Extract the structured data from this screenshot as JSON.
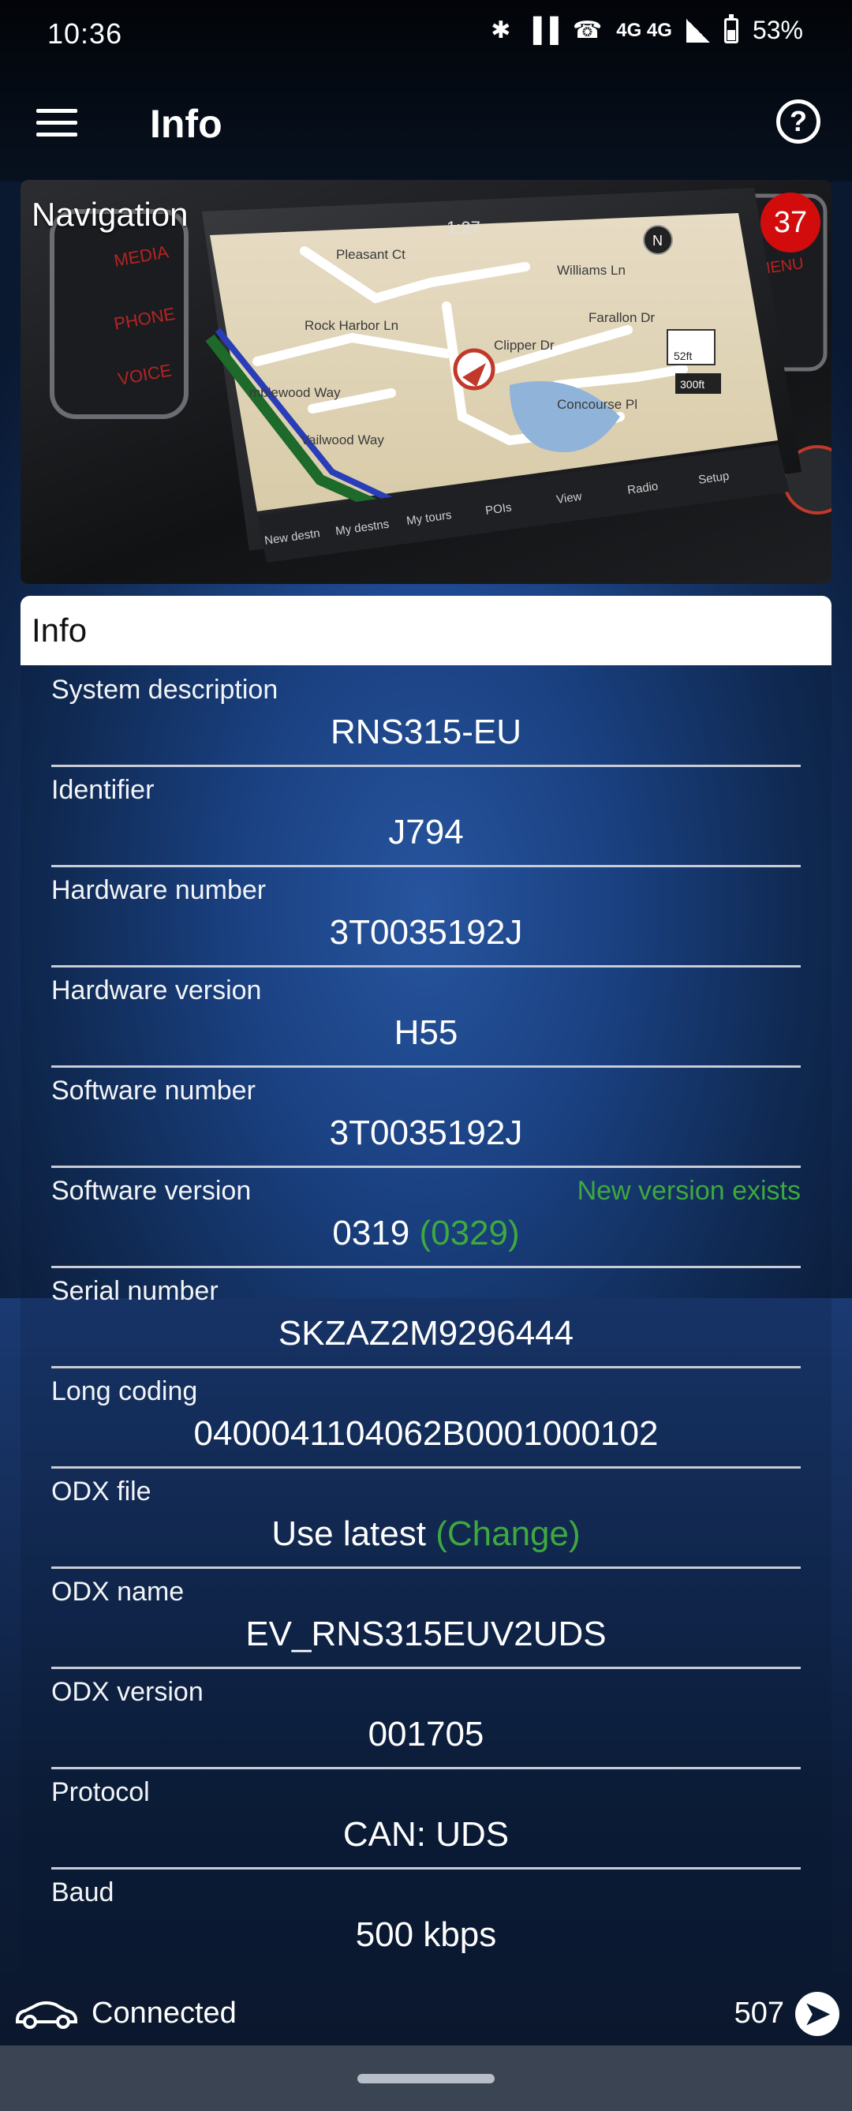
{
  "status_bar": {
    "time": "10:36",
    "network": "4G 4G",
    "battery": "53%"
  },
  "app_bar": {
    "title": "Info"
  },
  "hero": {
    "title": "Navigation",
    "badge": "37",
    "screen": {
      "time": "1:27",
      "streets": [
        "Pleasant Ct",
        "Williams Ln",
        "Rock Harbor Ln",
        "Farallon Dr",
        "Clipper Dr",
        "Concourse Pl",
        "Vailwood Way",
        "mblewood Way"
      ],
      "buttons": [
        "MEDIA",
        "PHONE",
        "VOICE",
        "MENU"
      ],
      "bottom_menu": [
        "New destn",
        "My destns",
        "My tours",
        "POIs",
        "View",
        "Radio",
        "Setup"
      ],
      "scale": [
        "52ft",
        "300ft"
      ]
    }
  },
  "card": {
    "title": "Info",
    "rows": [
      {
        "label": "System description",
        "value": "RNS315-EU"
      },
      {
        "label": "Identifier",
        "value": "J794"
      },
      {
        "label": "Hardware number",
        "value": "3T0035192J"
      },
      {
        "label": "Hardware version",
        "value": "H55"
      },
      {
        "label": "Software number",
        "value": "3T0035192J"
      },
      {
        "label": "Software version",
        "value": "0319",
        "value_extra": "(0329)",
        "note": "New version exists"
      },
      {
        "label": "Serial number",
        "value": "SKZAZ2M9296444"
      },
      {
        "label": "Long coding",
        "value": "0400041104062B0001000102"
      },
      {
        "label": "ODX file",
        "value": "Use latest",
        "value_extra": "(Change)"
      },
      {
        "label": "ODX name",
        "value": "EV_RNS315EUV2UDS"
      },
      {
        "label": "ODX version",
        "value": "001705"
      },
      {
        "label": "Protocol",
        "value": "CAN: UDS"
      },
      {
        "label": "Baud",
        "value": "500 kbps"
      }
    ]
  },
  "bottom_bar": {
    "status": "Connected",
    "counter": "507"
  },
  "colors": {
    "accent_green": "#3fa83f",
    "badge_red": "#d20c0c",
    "divider": "#c8ccd4"
  }
}
